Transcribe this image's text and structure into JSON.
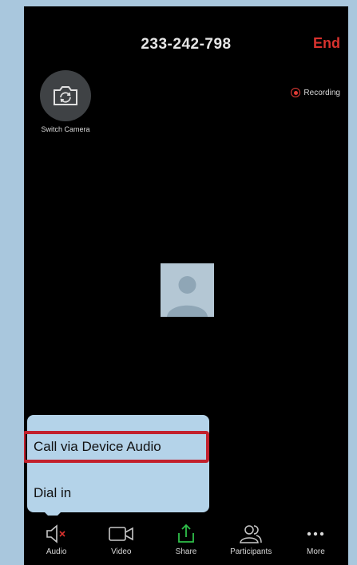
{
  "header": {
    "meeting_id": "233-242-798",
    "end_label": "End"
  },
  "controls": {
    "switch_camera_label": "Switch Camera",
    "recording_label": "Recording"
  },
  "audio_menu": {
    "options": [
      "Call via Device Audio",
      "Dial in"
    ],
    "highlighted": "Call via Device Audio"
  },
  "toolbar": {
    "items": [
      {
        "label": "Audio",
        "icon": "speaker-muted-icon"
      },
      {
        "label": "Video",
        "icon": "video-camera-icon"
      },
      {
        "label": "Share",
        "icon": "share-upload-icon"
      },
      {
        "label": "Participants",
        "icon": "participants-icon"
      },
      {
        "label": "More",
        "icon": "more-dots-icon"
      }
    ]
  },
  "colors": {
    "end": "#d9322e",
    "recording": "#e23b35",
    "share": "#2fbf4a",
    "highlight": "#c2212d",
    "popup": "#b4d3e9"
  }
}
